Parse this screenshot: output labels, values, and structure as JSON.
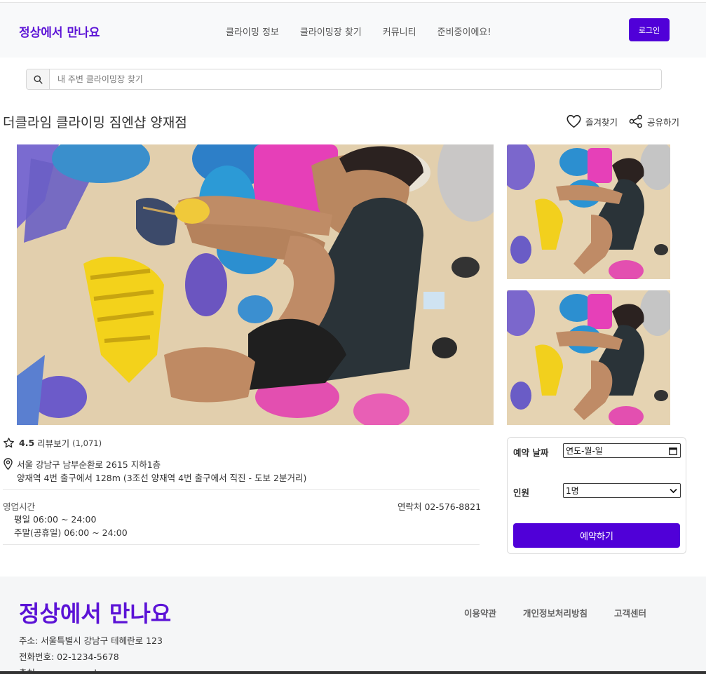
{
  "header": {
    "logo": "정상에서 만나요",
    "nav": [
      "클라이밍 정보",
      "클라이밍장 찾기",
      "커뮤니티",
      "준비중이에요!"
    ],
    "login_label": "로그인"
  },
  "search": {
    "placeholder": "내 주변 클라이밍장 찾기",
    "icon": "search-icon"
  },
  "gym": {
    "title": "더클라임 클라이밍 짐엔샵 양재점",
    "favorite_label": "즐겨찾기",
    "share_label": "공유하기",
    "rating": "4.5",
    "review_label": "리뷰보기",
    "review_count": "(1,071)",
    "address_line1": "서울 강남구 남부순환로 2615 지하1층",
    "address_line2": "양재역 4번 출구에서 128m (3조선 양재역 4번 출구에서 직진 - 도보 2분거리)",
    "hours_label": "영업시간",
    "hours_weekday": "평일 06:00 ~ 24:00",
    "hours_weekend": "주말(공휴일) 06:00 ~ 24:00",
    "contact": "연락처 02-576-8821"
  },
  "booking": {
    "date_label": "예약 날짜",
    "date_value": "연도-월-일",
    "people_label": "인원",
    "people_value": "1명",
    "reserve_label": "예약하기"
  },
  "footer": {
    "logo": "정상에서 만나요",
    "links": [
      "이용약관",
      "개인정보처리방침",
      "고객센터"
    ],
    "address": "주소: 서울특별시 강남구 테헤란로 123",
    "phone": "전화번호: 02-1234-5678",
    "url": "출처: www.example.com"
  },
  "colors": {
    "brand": "#5b12d6",
    "button": "#5000d8"
  }
}
